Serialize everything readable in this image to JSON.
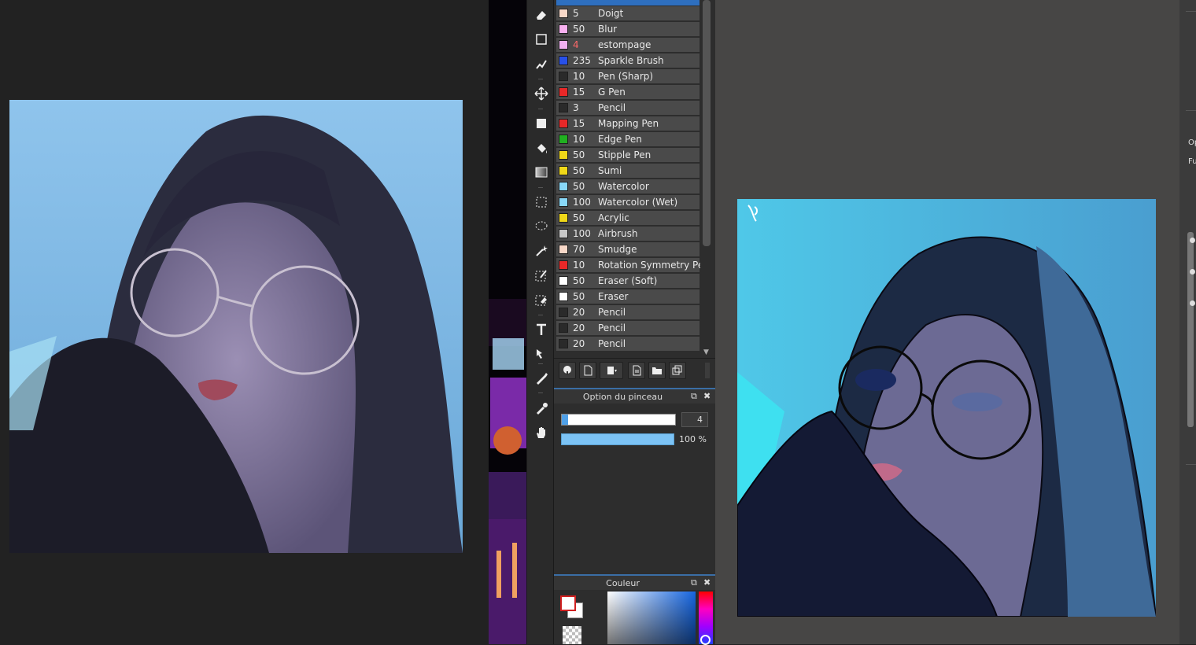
{
  "brush_list": {
    "items": [
      {
        "size": "5",
        "name": "Doigt",
        "color": "#f8d8c8",
        "size_color": "#e8e8e8"
      },
      {
        "size": "50",
        "name": "Blur",
        "color": "#f8b0f0",
        "size_color": "#e8e8e8"
      },
      {
        "size": "4",
        "name": "estompage",
        "color": "#f0b0f0",
        "size_color": "#ff6a6a"
      },
      {
        "size": "235",
        "name": "Sparkle Brush",
        "color": "#2850e8",
        "size_color": "#e8e8e8"
      },
      {
        "size": "10",
        "name": "Pen (Sharp)",
        "color": "#2a2a2a",
        "size_color": "#e8e8e8"
      },
      {
        "size": "15",
        "name": "G Pen",
        "color": "#e82828",
        "size_color": "#e8e8e8"
      },
      {
        "size": "3",
        "name": "Pencil",
        "color": "#2a2a2a",
        "size_color": "#e8e8e8"
      },
      {
        "size": "15",
        "name": "Mapping Pen",
        "color": "#e82828",
        "size_color": "#e8e8e8"
      },
      {
        "size": "10",
        "name": "Edge Pen",
        "color": "#20b020",
        "size_color": "#e8e8e8"
      },
      {
        "size": "50",
        "name": "Stipple Pen",
        "color": "#f0d818",
        "size_color": "#e8e8e8"
      },
      {
        "size": "50",
        "name": "Sumi",
        "color": "#f0d818",
        "size_color": "#e8e8e8"
      },
      {
        "size": "50",
        "name": "Watercolor",
        "color": "#88d8f8",
        "size_color": "#e8e8e8"
      },
      {
        "size": "100",
        "name": "Watercolor (Wet)",
        "color": "#88d8f8",
        "size_color": "#e8e8e8"
      },
      {
        "size": "50",
        "name": "Acrylic",
        "color": "#f0d818",
        "size_color": "#e8e8e8"
      },
      {
        "size": "100",
        "name": "Airbrush",
        "color": "#c8c8c8",
        "size_color": "#e8e8e8"
      },
      {
        "size": "70",
        "name": "Smudge",
        "color": "#f8d8c8",
        "size_color": "#e8e8e8"
      },
      {
        "size": "10",
        "name": "Rotation Symmetry Pen",
        "color": "#e82828",
        "size_color": "#e8e8e8"
      },
      {
        "size": "50",
        "name": "Eraser (Soft)",
        "color": "#ffffff",
        "size_color": "#e8e8e8"
      },
      {
        "size": "50",
        "name": "Eraser",
        "color": "#ffffff",
        "size_color": "#e8e8e8"
      },
      {
        "size": "20",
        "name": "Pencil",
        "color": "#2a2a2a",
        "size_color": "#e8e8e8"
      },
      {
        "size": "20",
        "name": "Pencil",
        "color": "#2a2a2a",
        "size_color": "#e8e8e8"
      },
      {
        "size": "20",
        "name": "Pencil",
        "color": "#2a2a2a",
        "size_color": "#e8e8e8"
      }
    ]
  },
  "brush_option": {
    "title": "Option du pinceau",
    "size_value": "4",
    "size_fraction": 0.03,
    "opacity_value": "100 %",
    "opacity_fraction": 1.0
  },
  "color_panel": {
    "title": "Couleur",
    "foreground": "#ffffff",
    "background": "#ffffff"
  },
  "right_panel": {
    "label_1": "Op",
    "label_2": "Fu"
  },
  "tools": [
    "eraser-tool",
    "shape-tool",
    "brush-stroke-tool",
    "move-tool",
    "fill-rect-tool",
    "bucket-tool",
    "gradient-tool",
    "select-rect-tool",
    "lasso-tool",
    "magic-wand-tool",
    "select-pen-tool",
    "select-eraser-tool",
    "text-tool",
    "layer-move-tool",
    "pen-tool",
    "eyedropper-tool",
    "hand-tool"
  ]
}
